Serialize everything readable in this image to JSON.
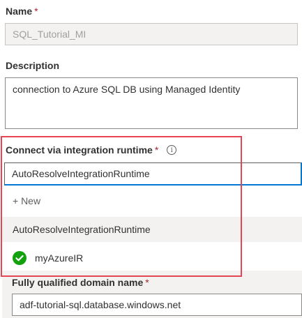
{
  "name": {
    "label": "Name",
    "required": "*",
    "value": "SQL_Tutorial_MI"
  },
  "description": {
    "label": "Description",
    "value": "connection to Azure SQL DB using Managed Identity"
  },
  "runtime": {
    "label": "Connect via integration runtime",
    "required": "*",
    "info": "i",
    "selected": "AutoResolveIntegrationRuntime",
    "options": {
      "new": "+ New",
      "auto": "AutoResolveIntegrationRuntime",
      "myir": "myAzureIR"
    }
  },
  "fqdn": {
    "label": "Fully qualified domain name",
    "required": "*",
    "value": "adf-tutorial-sql.database.windows.net"
  },
  "colors": {
    "highlight_border": "#e64553",
    "focus_blue": "#0078d4",
    "success_green": "#13a10e"
  },
  "icons": {
    "info": "info-icon",
    "check": "check-circle-icon"
  }
}
